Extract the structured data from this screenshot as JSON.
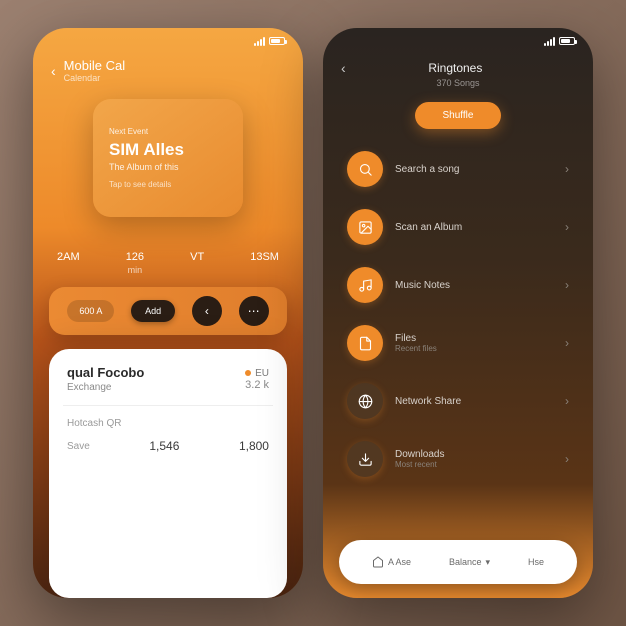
{
  "colors": {
    "accent": "#ef8b2a",
    "dark": "#2a1d14"
  },
  "left": {
    "status_time": "",
    "header_title": "Mobile Cal",
    "header_sub": "Calendar",
    "card": {
      "line1": "Next Event",
      "line2": "SIM Alles",
      "line3": "The Album of this",
      "line4": "Tap to see details"
    },
    "timeline": [
      {
        "val": "2AM",
        "lab": ""
      },
      {
        "val": "126",
        "lab": "min"
      },
      {
        "val": "VT",
        "lab": ""
      },
      {
        "val": "13SM",
        "lab": ""
      }
    ],
    "quickbar": {
      "label1": "600 A",
      "label2": "Add"
    },
    "bottom": {
      "title": "qual Focobo",
      "badge": "EU",
      "sub": "Exchange",
      "sub_val": "3.2 k",
      "col1_lab": "Hotcash QR",
      "col2_lab": "",
      "row1_lab": "Save",
      "row1_val": "1,546",
      "row2_val": "1,800"
    }
  },
  "right": {
    "header_title": "Ringtones",
    "header_sub": "370 Songs",
    "pill_label": "Shuffle",
    "menu": [
      {
        "icon": "search-icon",
        "label": "Search a song",
        "sub": "",
        "dark": false
      },
      {
        "icon": "image-icon",
        "label": "Scan an Album",
        "sub": "",
        "dark": false
      },
      {
        "icon": "music-icon",
        "label": "Music Notes",
        "sub": "",
        "dark": false
      },
      {
        "icon": "file-icon",
        "label": "Files",
        "sub": "Recent files",
        "dark": false
      },
      {
        "icon": "globe-icon",
        "label": "Network Share",
        "sub": "",
        "dark": true
      },
      {
        "icon": "download-icon",
        "label": "Downloads",
        "sub": "Most recent",
        "dark": true
      }
    ],
    "nav": {
      "a": "A Ase",
      "b": "Balance",
      "c": "Hse"
    }
  }
}
